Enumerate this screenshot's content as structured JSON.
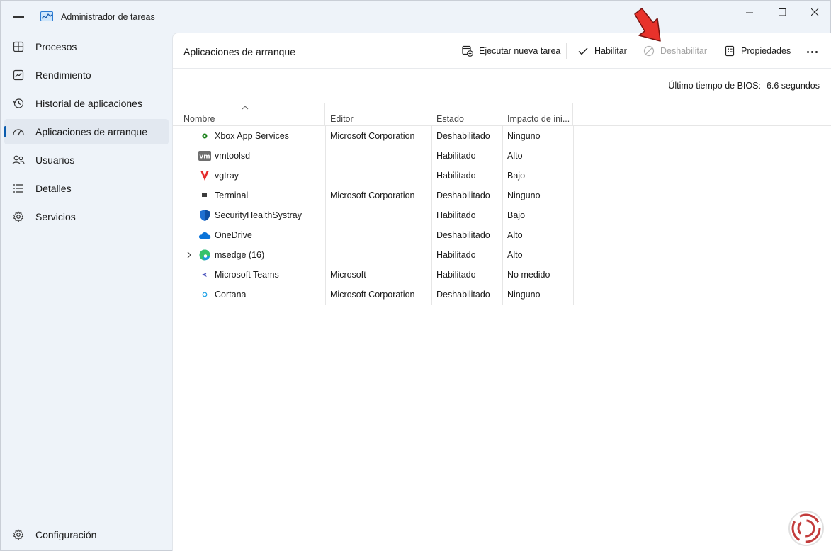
{
  "window": {
    "title": "Administrador de tareas"
  },
  "sidebar": {
    "items": [
      {
        "label": "Procesos",
        "icon": "processes-grid-icon"
      },
      {
        "label": "Rendimiento",
        "icon": "performance-chart-icon"
      },
      {
        "label": "Historial de aplicaciones",
        "icon": "history-clock-icon"
      },
      {
        "label": "Aplicaciones de arranque",
        "icon": "startup-gauge-icon",
        "active": true
      },
      {
        "label": "Usuarios",
        "icon": "users-icon"
      },
      {
        "label": "Detalles",
        "icon": "details-list-icon"
      },
      {
        "label": "Servicios",
        "icon": "services-gear-icon"
      }
    ],
    "settings_label": "Configuración"
  },
  "toolbar": {
    "page_title": "Aplicaciones de arranque",
    "run_new_task": "Ejecutar nueva tarea",
    "enable": "Habilitar",
    "disable": "Deshabilitar",
    "properties": "Propiedades"
  },
  "bios": {
    "label": "Último tiempo de BIOS:",
    "value": "6.6 segundos"
  },
  "table": {
    "columns": [
      "Nombre",
      "Editor",
      "Estado",
      "Impacto de ini..."
    ],
    "rows": [
      {
        "name": "Xbox App Services",
        "publisher": "Microsoft Corporation",
        "status": "Deshabilitado",
        "impact": "Ninguno",
        "icon": "xbox-icon"
      },
      {
        "name": "vmtoolsd",
        "publisher": "",
        "status": "Habilitado",
        "impact": "Alto",
        "icon": "vmware-icon"
      },
      {
        "name": "vgtray",
        "publisher": "",
        "status": "Habilitado",
        "impact": "Bajo",
        "icon": "vanguard-icon"
      },
      {
        "name": "Terminal",
        "publisher": "Microsoft Corporation",
        "status": "Deshabilitado",
        "impact": "Ninguno",
        "icon": "terminal-icon"
      },
      {
        "name": "SecurityHealthSystray",
        "publisher": "",
        "status": "Habilitado",
        "impact": "Bajo",
        "icon": "shield-icon"
      },
      {
        "name": "OneDrive",
        "publisher": "",
        "status": "Deshabilitado",
        "impact": "Alto",
        "icon": "onedrive-cloud-icon"
      },
      {
        "name": "msedge (16)",
        "publisher": "",
        "status": "Habilitado",
        "impact": "Alto",
        "icon": "edge-icon",
        "expandable": true
      },
      {
        "name": "Microsoft Teams",
        "publisher": "Microsoft",
        "status": "Habilitado",
        "impact": "No medido",
        "icon": "teams-icon"
      },
      {
        "name": "Cortana",
        "publisher": "Microsoft Corporation",
        "status": "Deshabilitado",
        "impact": "Ninguno",
        "icon": "cortana-icon"
      }
    ]
  },
  "colors": {
    "accent": "#0b5cad",
    "annotation_arrow": "#e8322b"
  }
}
